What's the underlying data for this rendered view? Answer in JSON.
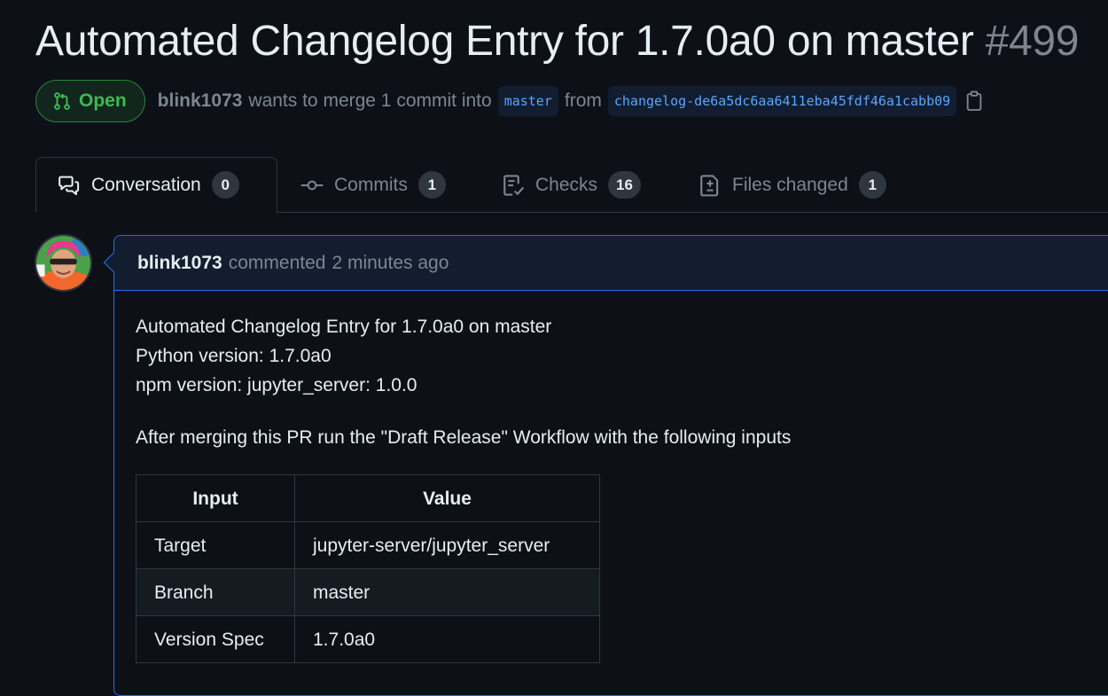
{
  "pr": {
    "title": "Automated Changelog Entry for 1.7.0a0 on master",
    "number": "#499",
    "state": "Open",
    "author": "blink1073",
    "merge_text": "wants to merge 1 commit into",
    "base_branch": "master",
    "from_text": "from",
    "head_branch": "changelog-de6a5dc6aa6411eba45fdf46a1cabb09"
  },
  "tabs": [
    {
      "label": "Conversation",
      "count": "0",
      "icon": "comment-discussion-icon",
      "selected": true
    },
    {
      "label": "Commits",
      "count": "1",
      "icon": "git-commit-icon",
      "selected": false
    },
    {
      "label": "Checks",
      "count": "16",
      "icon": "checklist-icon",
      "selected": false
    },
    {
      "label": "Files changed",
      "count": "1",
      "icon": "file-diff-icon",
      "selected": false
    }
  ],
  "comment": {
    "author": "blink1073",
    "action": "commented",
    "time": "2 minutes ago",
    "lines": [
      "Automated Changelog Entry for 1.7.0a0 on master",
      "Python version: 1.7.0a0",
      "npm version: jupyter_server: 1.0.0"
    ],
    "paragraph": "After merging this PR run the \"Draft Release\" Workflow with the following inputs",
    "table": {
      "headers": [
        "Input",
        "Value"
      ],
      "rows": [
        [
          "Target",
          "jupyter-server/jupyter_server"
        ],
        [
          "Branch",
          "master"
        ],
        [
          "Version Spec",
          "1.7.0a0"
        ]
      ]
    }
  },
  "colors": {
    "background": "#0d1117",
    "open_green": "#3fb950",
    "link_blue": "#58a6ff",
    "comment_border": "#1f6feb"
  }
}
